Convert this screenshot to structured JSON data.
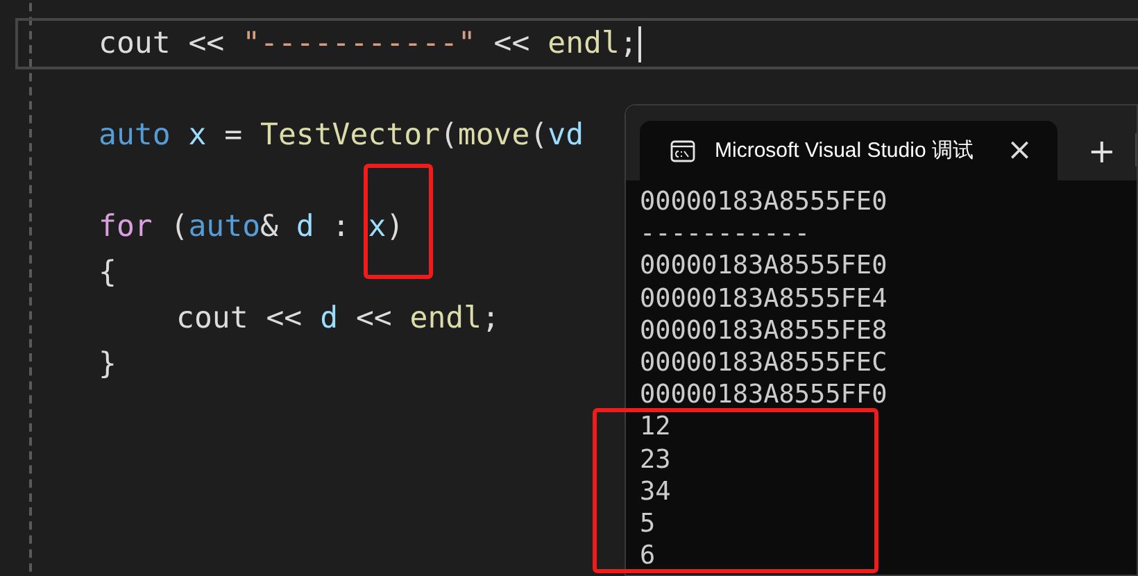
{
  "editor": {
    "lines": [
      {
        "kind": "blank"
      },
      {
        "kind": "code",
        "current": true,
        "tokens": [
          {
            "text": "cout << ",
            "kind": "plain"
          },
          {
            "text": "\"-----------\"",
            "kind": "string"
          },
          {
            "text": " << ",
            "kind": "plain"
          },
          {
            "text": "endl",
            "kind": "func"
          },
          {
            "text": ";",
            "kind": "plain"
          }
        ]
      },
      {
        "kind": "blank"
      },
      {
        "kind": "code",
        "current": false,
        "tokens": [
          {
            "text": "auto",
            "kind": "keyword"
          },
          {
            "text": " x",
            "kind": "var"
          },
          {
            "text": " = ",
            "kind": "plain"
          },
          {
            "text": "TestVector",
            "kind": "func"
          },
          {
            "text": "(",
            "kind": "plain"
          },
          {
            "text": "move",
            "kind": "func"
          },
          {
            "text": "(",
            "kind": "plain"
          },
          {
            "text": "vd",
            "kind": "var"
          }
        ]
      },
      {
        "kind": "blank"
      },
      {
        "kind": "code",
        "current": false,
        "tokens": [
          {
            "text": "for",
            "kind": "control"
          },
          {
            "text": " (",
            "kind": "plain"
          },
          {
            "text": "auto",
            "kind": "keyword"
          },
          {
            "text": "& ",
            "kind": "plain"
          },
          {
            "text": "d",
            "kind": "var"
          },
          {
            "text": " : ",
            "kind": "plain"
          },
          {
            "text": "x",
            "kind": "var"
          },
          {
            "text": ")",
            "kind": "plain"
          }
        ]
      },
      {
        "kind": "code",
        "current": false,
        "tokens": [
          {
            "text": "{",
            "kind": "plain"
          }
        ],
        "children": [
          {
            "kind": "code",
            "current": false,
            "tokens": [
              {
                "text": "cout << ",
                "kind": "plain"
              },
              {
                "text": "d",
                "kind": "var"
              },
              {
                "text": " << ",
                "kind": "plain"
              },
              {
                "text": "endl",
                "kind": "func"
              },
              {
                "text": ";",
                "kind": "plain"
              }
            ]
          }
        ]
      },
      {
        "kind": "code",
        "current": false,
        "tokens": [
          {
            "text": "}",
            "kind": "plain"
          }
        ]
      }
    ]
  },
  "terminal": {
    "tabs": [
      {
        "title": "Microsoft Visual Studio 调试",
        "selected": true,
        "close": "×"
      }
    ],
    "new_tab": "+",
    "output": [
      "00000183A8555FE0",
      "-----------",
      "00000183A8555FE0",
      "00000183A8555FE4",
      "00000183A8555FE8",
      "00000183A8555FEC",
      "00000183A8555FF0",
      "12",
      "23",
      "34",
      "5",
      "6"
    ]
  }
}
